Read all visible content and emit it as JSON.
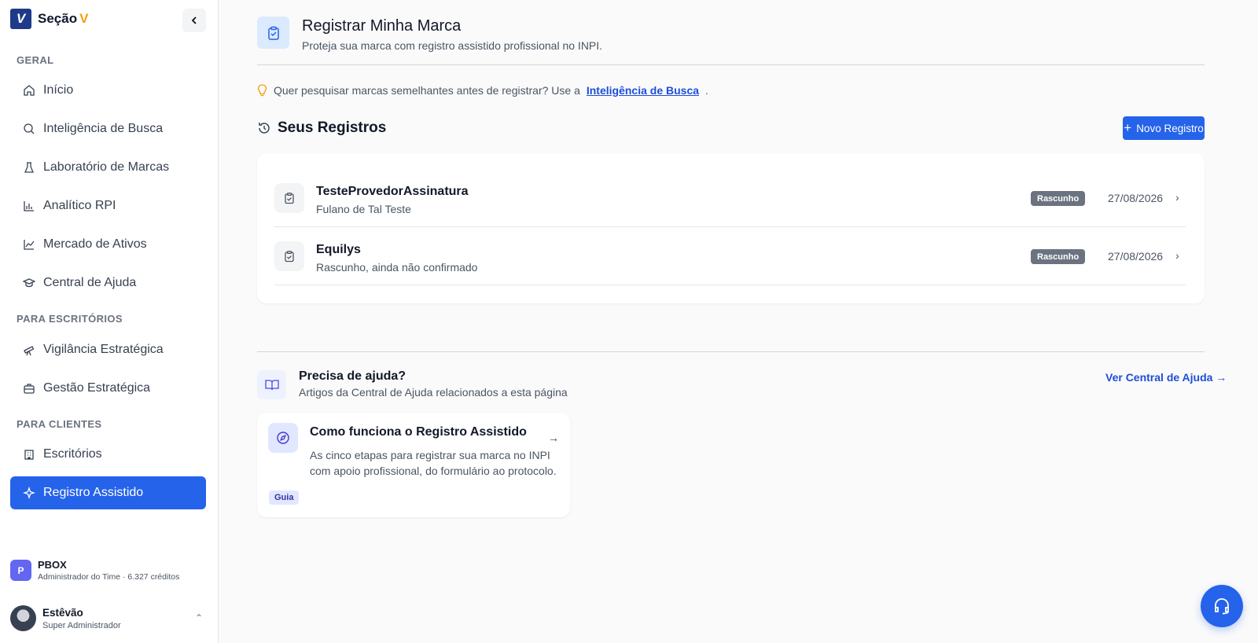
{
  "brand": {
    "logo_letter": "V",
    "name": "Seção",
    "accent": "V"
  },
  "sidebar": {
    "sections": [
      {
        "label": "GERAL"
      },
      {
        "label": "PARA ESCRITÓRIOS"
      },
      {
        "label": "PARA CLIENTES"
      }
    ],
    "items": [
      {
        "label": "Início",
        "icon": "home-icon"
      },
      {
        "label": "Inteligência de Busca",
        "icon": "search-icon"
      },
      {
        "label": "Laboratório de Marcas",
        "icon": "flask-icon"
      },
      {
        "label": "Analítico RPI",
        "icon": "bar-chart-icon"
      },
      {
        "label": "Mercado de Ativos",
        "icon": "line-chart-icon"
      },
      {
        "label": "Central de Ajuda",
        "icon": "graduation-cap-icon"
      },
      {
        "label": "Vigilância Estratégica",
        "icon": "telescope-icon"
      },
      {
        "label": "Gestão Estratégica",
        "icon": "briefcase-icon"
      },
      {
        "label": "Escritórios",
        "icon": "building-icon"
      },
      {
        "label": "Registro Assistido",
        "icon": "sparkles-icon",
        "active": true
      }
    ],
    "team": {
      "initial": "P",
      "name": "PBOX",
      "subtitle": "Administrador do Time · 6.327 créditos"
    },
    "user": {
      "name": "Estêvão",
      "role": "Super Administrador"
    }
  },
  "page": {
    "title": "Registrar Minha Marca",
    "subtitle": "Proteja sua marca com registro assistido profissional no INPI.",
    "tip": {
      "text_before": "Quer pesquisar marcas semelhantes antes de registrar? Use a",
      "link": "Inteligência de Busca",
      "text_after": "."
    },
    "registros": {
      "title": "Seus Registros",
      "new_button": "Novo Registro",
      "rows": [
        {
          "title": "TesteProvedorAssinatura",
          "subtitle": "Fulano de Tal Teste",
          "status": "Rascunho",
          "date": "27/08/2026"
        },
        {
          "title": "Equilys",
          "subtitle": "Rascunho, ainda não confirmado",
          "status": "Rascunho",
          "date": "27/08/2026"
        }
      ]
    },
    "help": {
      "title": "Precisa de ajuda?",
      "subtitle": "Artigos da Central de Ajuda relacionados a esta página",
      "link": "Ver Central de Ajuda →",
      "article": {
        "title": "Como funciona o Registro Assistido",
        "description": "As cinco etapas para registrar sua marca no INPI com apoio profissional, do formulário ao protocolo.",
        "tag": "Guia"
      }
    }
  },
  "colors": {
    "primary": "#2563eb",
    "accent": "#f59e0b",
    "badge": "#6b7280"
  }
}
